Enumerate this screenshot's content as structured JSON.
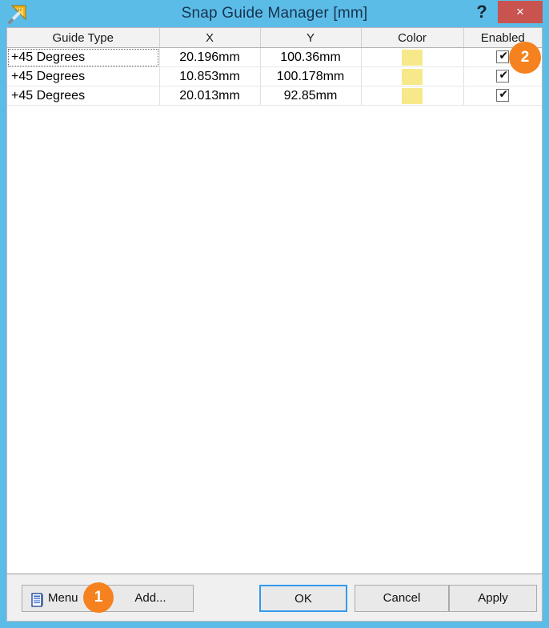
{
  "window": {
    "title": "Snap Guide Manager [mm]",
    "icon": "ruler-triangle-icon",
    "help_label": "?",
    "close_label": "×",
    "accent_color": "#5CBCE8",
    "close_color": "#C9534F"
  },
  "table": {
    "columns": [
      "Guide Type",
      "X",
      "Y",
      "Color",
      "Enabled"
    ],
    "rows": [
      {
        "guide_type": "+45 Degrees",
        "x": "20.196mm",
        "y": "100.36mm",
        "color": "#F7E98A",
        "enabled": true,
        "selected": true
      },
      {
        "guide_type": "+45 Degrees",
        "x": "10.853mm",
        "y": "100.178mm",
        "color": "#F7E98A",
        "enabled": true,
        "selected": false
      },
      {
        "guide_type": "+45 Degrees",
        "x": "20.013mm",
        "y": "92.85mm",
        "color": "#F7E98A",
        "enabled": true,
        "selected": false
      }
    ],
    "check_glyph": "✔",
    "selection_color": "#2185E4"
  },
  "footer": {
    "menu_label": "Menu",
    "menu_icon": "list-document-icon",
    "add_label": "Add...",
    "ok_label": "OK",
    "cancel_label": "Cancel",
    "apply_label": "Apply"
  },
  "annotations": {
    "badge_color": "#F5821F",
    "badge_one": "1",
    "badge_two": "2"
  }
}
